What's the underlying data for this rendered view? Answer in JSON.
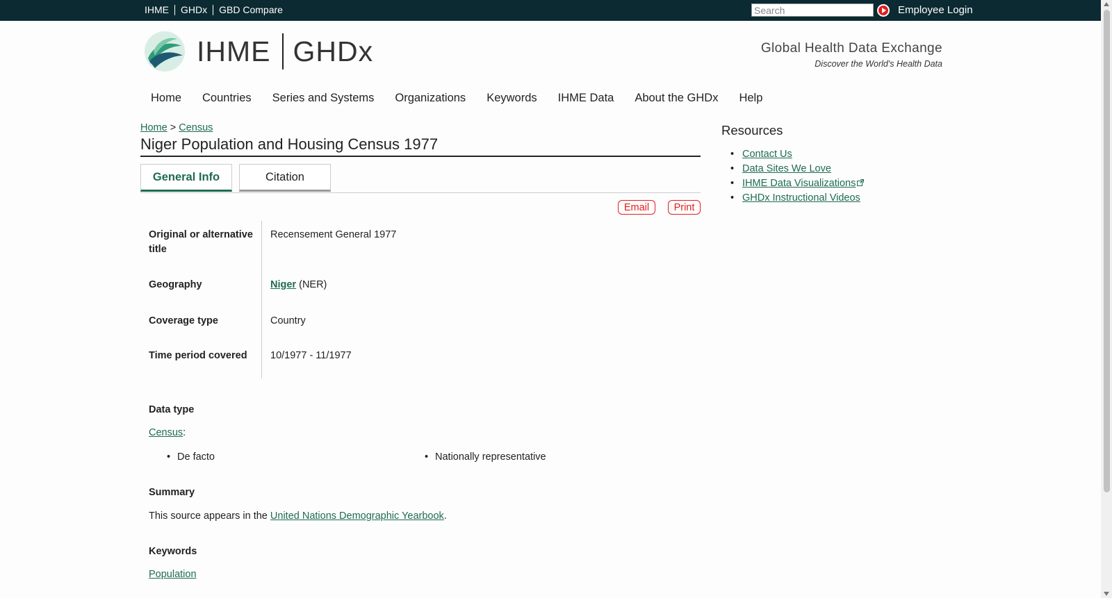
{
  "topbar": {
    "links": [
      "IHME",
      "GHDx",
      "GBD Compare"
    ],
    "search_placeholder": "Search",
    "employee_login": "Employee Login"
  },
  "header": {
    "logo_ihme": "IHME",
    "logo_ghdx": "GHDx",
    "tagline_title": "Global Health Data Exchange",
    "tagline_sub": "Discover the World's Health Data"
  },
  "nav": [
    "Home",
    "Countries",
    "Series and Systems",
    "Organizations",
    "Keywords",
    "IHME Data",
    "About the GHDx",
    "Help"
  ],
  "breadcrumb": {
    "home": "Home",
    "separator": ">",
    "current": "Census"
  },
  "page_title": "Niger Population and Housing Census 1977",
  "tabs": {
    "general": "General Info",
    "citation": "Citation"
  },
  "actions": {
    "email": "Email",
    "print": "Print"
  },
  "info": {
    "alt_title_label": "Original or alternative title",
    "alt_title_value": "Recensement General 1977",
    "geography_label": "Geography",
    "geography_link": "Niger",
    "geography_code": "(NER)",
    "coverage_label": "Coverage type",
    "coverage_value": "Country",
    "time_label": "Time period covered",
    "time_value": "10/1977 - 11/1977"
  },
  "data_type": {
    "heading": "Data type",
    "link": "Census",
    "suffix": ":",
    "bullets": [
      "De facto",
      "Nationally representative"
    ]
  },
  "summary": {
    "heading": "Summary",
    "text_before": "This source appears in the ",
    "link": "United Nations Demographic Yearbook",
    "text_after": "."
  },
  "keywords": {
    "heading": "Keywords",
    "link": "Population"
  },
  "resources": {
    "title": "Resources",
    "items": [
      "Contact Us",
      "Data Sites We Love",
      "IHME Data Visualizations",
      "GHDx Instructional Videos"
    ]
  },
  "colors": {
    "topbar": "#0b2a32",
    "link": "#1e6b52",
    "accent_red": "#e21d1d"
  }
}
